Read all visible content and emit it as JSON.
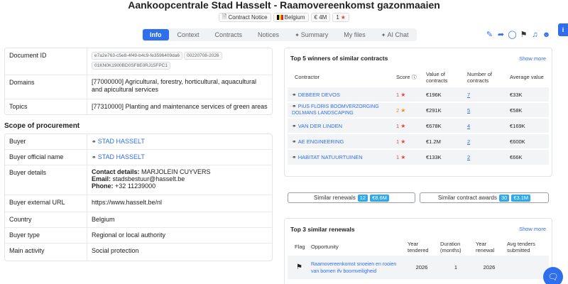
{
  "title": "Aankoopcentrale Stad Hasselt - Raamovereenkomst gazonmaaien",
  "badges": {
    "notice": "Contract Notice",
    "country": "Belgium",
    "value": "€ 4M",
    "score": "1"
  },
  "tabs": [
    {
      "label": "Info"
    },
    {
      "label": "Context"
    },
    {
      "label": "Contracts"
    },
    {
      "label": "Notices"
    },
    {
      "label": "Summary"
    },
    {
      "label": "My files"
    },
    {
      "label": "AI Chat"
    }
  ],
  "info_tab": "i",
  "details": {
    "document_id_label": "Document ID",
    "document_ids": [
      "e7a2e763-c5e8-4f49-b4c9-fe3596409da6",
      "00220708-2026",
      "01KN0K1900BD0SF8E0RJ15FPC1"
    ],
    "domains_label": "Domains",
    "domains_value": "[77000000] Agricultural, forestry, horticultural, aquacultural and apicultural services",
    "topics_label": "Topics",
    "topics_value": "[77310000] Planting and maintenance services of green areas"
  },
  "scope": {
    "title": "Scope of procurement",
    "buyer_label": "Buyer",
    "buyer_value": "STAD HASSELT",
    "official_label": "Buyer official name",
    "official_value": "STAD HASSELT",
    "details_label": "Buyer details",
    "contact_key": "Contact details:",
    "contact_value": "MARJOLEIN CUYVERS",
    "email_key": "Email:",
    "email_value": "stadsbestuur@hasselt.be",
    "phone_key": "Phone:",
    "phone_value": "+32 11239000",
    "url_label": "Buyer external URL",
    "url_value": "https://www.hasselt.be/nl",
    "country_label": "Country",
    "country_value": "Belgium",
    "type_label": "Buyer type",
    "type_value": "Regional or local authority",
    "activity_label": "Main activity",
    "activity_value": "Social protection"
  },
  "winners": {
    "title": "Top 5 winners of similar contracts",
    "show_more": "Show more",
    "headers": {
      "contractor": "Contractor",
      "score": "Score",
      "value": "Value of contracts",
      "number": "Number of contracts",
      "average": "Average value"
    },
    "rows": [
      {
        "name": "DEBEER DEVOS",
        "score": "1",
        "value": "€196K",
        "number": "7",
        "average": "€33K"
      },
      {
        "name": "PIUS FLORIS BOOMVERZORGING DOLMANS LANDSCAPING",
        "score": "2",
        "value": "€291K",
        "number": "5",
        "average": "€58K"
      },
      {
        "name": "VAN DER LINDEN",
        "score": "1",
        "value": "€678K",
        "number": "4",
        "average": "€169K"
      },
      {
        "name": "AE ENGINEERING",
        "score": "1",
        "value": "€1.2M",
        "number": "2",
        "average": "€600K"
      },
      {
        "name": "HABITAT NATUURTUINEN",
        "score": "1",
        "value": "€133K",
        "number": "2",
        "average": "€66K"
      }
    ]
  },
  "similar_renewals_btn": {
    "label": "Similar renewals",
    "count": "12",
    "amount": "€8.6M"
  },
  "similar_awards_btn": {
    "label": "Similar contract awards",
    "count": "30",
    "amount": "€3.1M"
  },
  "renewals": {
    "title": "Top 3 similar renewals",
    "show_more": "Show more",
    "headers": {
      "flag": "Flag",
      "opportunity": "Opportunity",
      "year_tendered": "Year tendered",
      "duration": "Duration (months)",
      "year_renewal": "Year renewal",
      "avg_tenders": "Avg tenders submitted"
    },
    "rows": [
      {
        "opportunity": "Raamovereenkomst snoeien en rooien van bomen ifv boomveiligheid",
        "year_tendered": "2026",
        "duration": "1",
        "year_renewal": "2026",
        "avg_tenders": ""
      }
    ]
  },
  "colors": {
    "accent": "#2f6fed",
    "star_red": "#e04b3a",
    "star_orange": "#f0902a",
    "count_badge": "#2fa8e8"
  }
}
